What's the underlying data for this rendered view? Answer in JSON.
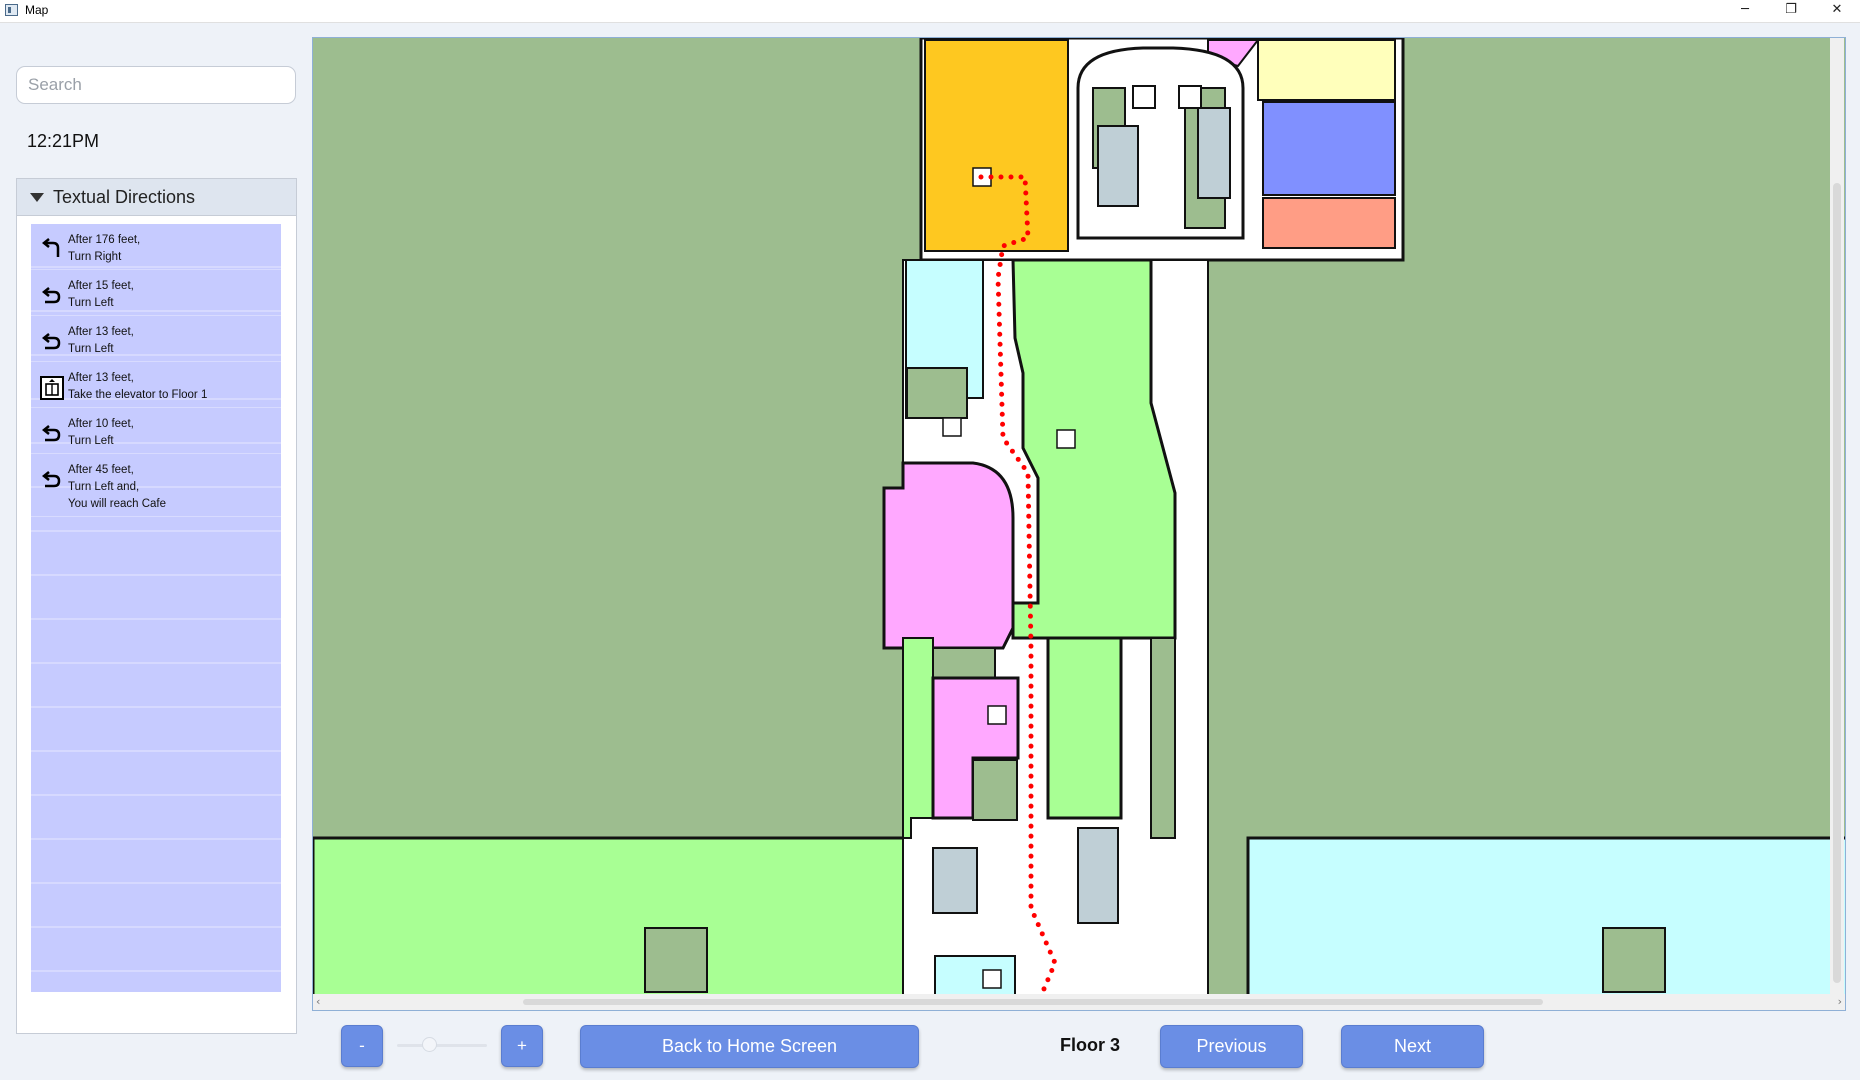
{
  "window": {
    "title": "Map",
    "minimize": "─",
    "maximize": "❐",
    "close": "✕"
  },
  "search": {
    "placeholder": "Search",
    "value": ""
  },
  "clock": "12:21PM",
  "directions": {
    "header": "Textual Directions",
    "items": [
      {
        "icon": "turn-right-icon",
        "lines": [
          "After 176 feet,",
          "Turn Right"
        ]
      },
      {
        "icon": "turn-left-icon",
        "lines": [
          "After 15 feet,",
          "Turn Left"
        ]
      },
      {
        "icon": "turn-left-icon",
        "lines": [
          "After 13 feet,",
          "Turn Left"
        ]
      },
      {
        "icon": "elevator-icon",
        "lines": [
          "After 13 feet,",
          "Take the elevator to Floor 1"
        ]
      },
      {
        "icon": "turn-left-icon",
        "lines": [
          "After 10 feet,",
          "Turn Left"
        ]
      },
      {
        "icon": "turn-left-icon",
        "lines": [
          "After 45 feet,",
          "Turn Left and,",
          "You will reach Cafe"
        ]
      }
    ]
  },
  "map": {
    "colors": {
      "background": "#9dbd8f",
      "hallway": "#ffffff",
      "green": "#a8ff94",
      "cyan": "#c6feff",
      "pink": "#ffa8ff",
      "orange": "#fec820",
      "yellow": "#ffffbb",
      "blue": "#8090ff",
      "salmon": "#ff9d85",
      "gray": "#bfcfd6",
      "path": "#ff0000"
    }
  },
  "controls": {
    "zoom_out": "-",
    "zoom_in": "+",
    "home": "Back to Home Screen",
    "floor": "Floor 3",
    "previous": "Previous",
    "next": "Next",
    "zoom_level": 0.35
  }
}
